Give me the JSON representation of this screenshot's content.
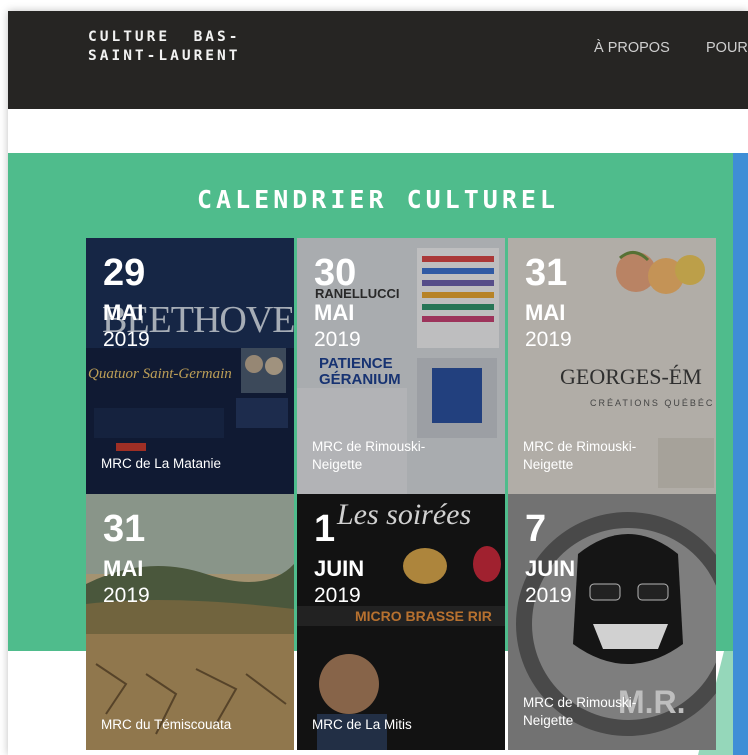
{
  "site": {
    "logo_line1": "CULTURE  BAS-",
    "logo_line2": "SAINT-LAURENT"
  },
  "nav": {
    "items": [
      "À PROPOS",
      "POUR"
    ]
  },
  "calendar": {
    "title": "CALENDRIER CULTUREL",
    "events": [
      {
        "day": "29",
        "month": "MAI",
        "year": "2019",
        "region": "MRC de La Matanie",
        "poster_text": "BEETHOVE",
        "poster_sub": "Quatuor Saint-Germain"
      },
      {
        "day": "30",
        "month": "MAI",
        "year": "2019",
        "region": "MRC de Rimouski-Neigette",
        "poster_text": "PATIENCE GÉRANIUM",
        "poster_sub": "RANELLUCCI"
      },
      {
        "day": "31",
        "month": "MAI",
        "year": "2019",
        "region": "MRC de Rimouski-Neigette",
        "poster_text": "GEORGES-ÉM",
        "poster_sub": "CRÉATIONS QUÉBÉC"
      },
      {
        "day": "31",
        "month": "MAI",
        "year": "2019",
        "region": "MRC du Témiscouata",
        "poster_text": "",
        "poster_sub": ""
      },
      {
        "day": "1",
        "month": "JUIN",
        "year": "2019",
        "region": "MRC de La Mitis",
        "poster_text": "Les soirées",
        "poster_sub": "MICRO BRASSE RIR"
      },
      {
        "day": "7",
        "month": "JUIN",
        "year": "2019",
        "region": "MRC de Rimouski-Neigette",
        "poster_text": "M.R.",
        "poster_sub": ""
      }
    ]
  },
  "colors": {
    "navbar": "#262523",
    "section": "#4fbc8c",
    "accent_blue": "#3f8ed6"
  }
}
